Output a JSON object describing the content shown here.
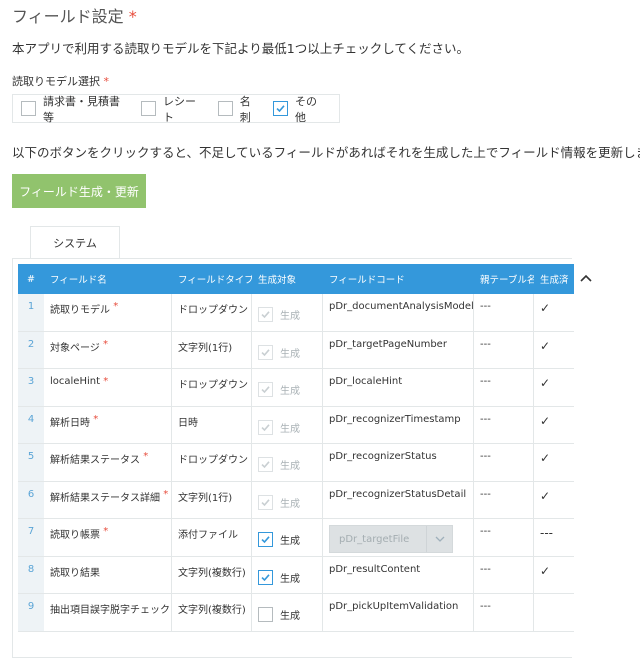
{
  "page": {
    "title": "フィールド設定",
    "required_mark": "*",
    "description": "本アプリで利用する読取りモデルを下記より最低1つ以上チェックしてください。"
  },
  "model_select": {
    "label": "読取りモデル選択",
    "options": [
      {
        "label": "請求書・見積書等",
        "checked": false
      },
      {
        "label": "レシート",
        "checked": false
      },
      {
        "label": "名刺",
        "checked": false
      },
      {
        "label": "その他",
        "checked": true
      }
    ]
  },
  "generate": {
    "description": "以下のボタンをクリックすると、不足しているフィールドがあればそれを生成した上でフィールド情報を更新します。",
    "button_label": "フィールド生成・更新"
  },
  "tabs": [
    {
      "label": "システム",
      "active": true
    }
  ],
  "table": {
    "headers": {
      "no": "#",
      "name": "フィールド名",
      "type": "フィールドタイプ",
      "gen": "生成対象",
      "code": "フィールドコード",
      "parent": "親テーブル名",
      "done": "生成済"
    },
    "gen_label": "生成",
    "rows": [
      {
        "no": "1",
        "name": "読取りモデル",
        "required": true,
        "type": "ドロップダウン",
        "gen_checked": true,
        "gen_disabled": true,
        "code": "pDr_documentAnalysisModel",
        "code_select": false,
        "parent": "---",
        "done": "✓"
      },
      {
        "no": "2",
        "name": "対象ページ",
        "required": true,
        "type": "文字列(1行)",
        "gen_checked": true,
        "gen_disabled": true,
        "code": "pDr_targetPageNumber",
        "code_select": false,
        "parent": "---",
        "done": "✓"
      },
      {
        "no": "3",
        "name": "localeHint",
        "required": true,
        "type": "ドロップダウン",
        "gen_checked": true,
        "gen_disabled": true,
        "code": "pDr_localeHint",
        "code_select": false,
        "parent": "---",
        "done": "✓"
      },
      {
        "no": "4",
        "name": "解析日時",
        "required": true,
        "type": "日時",
        "gen_checked": true,
        "gen_disabled": true,
        "code": "pDr_recognizerTimestamp",
        "code_select": false,
        "parent": "---",
        "done": "✓"
      },
      {
        "no": "5",
        "name": "解析結果ステータス",
        "required": true,
        "type": "ドロップダウン",
        "gen_checked": true,
        "gen_disabled": true,
        "code": "pDr_recognizerStatus",
        "code_select": false,
        "parent": "---",
        "done": "✓"
      },
      {
        "no": "6",
        "name": "解析結果ステータス詳細",
        "required": true,
        "type": "文字列(1行)",
        "gen_checked": true,
        "gen_disabled": true,
        "code": "pDr_recognizerStatusDetail",
        "code_select": false,
        "parent": "---",
        "done": "✓"
      },
      {
        "no": "7",
        "name": "読取り帳票",
        "required": true,
        "type": "添付ファイル",
        "gen_checked": true,
        "gen_disabled": false,
        "code": "pDr_targetFile",
        "code_select": true,
        "parent": "---",
        "done": "---"
      },
      {
        "no": "8",
        "name": "読取り結果",
        "required": false,
        "type": "文字列(複数行)",
        "gen_checked": true,
        "gen_disabled": false,
        "code": "pDr_resultContent",
        "code_select": false,
        "parent": "---",
        "done": "✓"
      },
      {
        "no": "9",
        "name": "抽出項目誤字脱字チェック",
        "required": false,
        "type": "文字列(複数行)",
        "gen_checked": false,
        "gen_disabled": false,
        "code": "pDr_pickUpItemValidation",
        "code_select": false,
        "parent": "---",
        "done": ""
      }
    ]
  },
  "colors": {
    "accent": "#3498db",
    "button": "#91c36d",
    "required": "#e74c3c"
  }
}
